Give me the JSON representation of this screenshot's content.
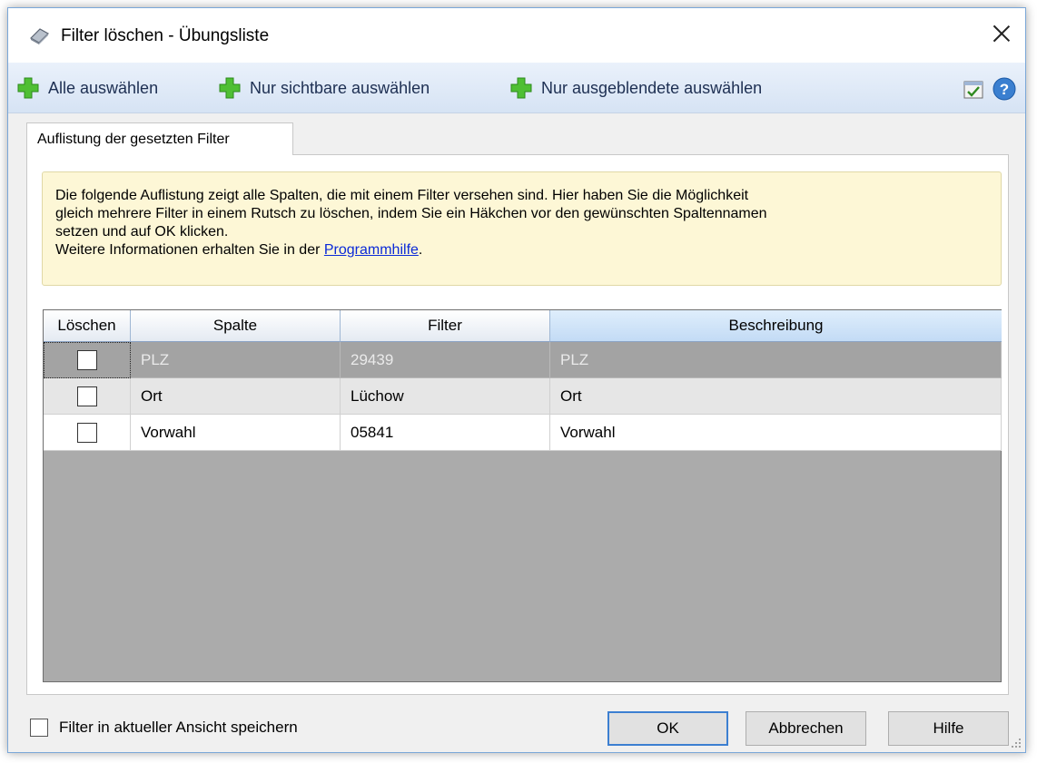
{
  "window": {
    "title": "Filter löschen - Übungsliste"
  },
  "toolbar": {
    "select_all": "Alle auswählen",
    "select_visible": "Nur sichtbare auswählen",
    "select_hidden": "Nur ausgeblendete auswählen",
    "icons": [
      "plus-icon",
      "checklist-icon",
      "help-icon"
    ]
  },
  "tab": {
    "label": "Auflistung der gesetzten Filter"
  },
  "info": {
    "line1": "Die folgende Auflistung zeigt alle Spalten, die mit einem Filter versehen sind. Hier haben Sie die Möglichkeit",
    "line2": "gleich mehrere Filter in einem Rutsch zu löschen, indem Sie ein Häkchen vor den gewünschten Spaltennamen",
    "line3": "setzen und auf OK klicken.",
    "line4_prefix": "Weitere Informationen erhalten Sie in der ",
    "link": "Programmhilfe",
    "line4_suffix": "."
  },
  "grid": {
    "columns": [
      "Löschen",
      "Spalte",
      "Filter",
      "Beschreibung"
    ],
    "rows": [
      {
        "checked": false,
        "spalte": "PLZ",
        "filter": "29439",
        "beschreibung": "PLZ"
      },
      {
        "checked": false,
        "spalte": "Ort",
        "filter": "Lüchow",
        "beschreibung": "Ort"
      },
      {
        "checked": false,
        "spalte": "Vorwahl",
        "filter": "05841",
        "beschreibung": "Vorwahl"
      }
    ]
  },
  "footer": {
    "save_checkbox_label": "Filter in aktueller Ansicht speichern",
    "ok": "OK",
    "cancel": "Abbrechen",
    "help": "Hilfe"
  },
  "colors": {
    "toolbar_bg": "#dfe8f5",
    "plus_green": "#3fae29",
    "selected_row": "#a3a3a3",
    "info_bg": "#fdf7d6",
    "link": "#0b2ad8"
  }
}
